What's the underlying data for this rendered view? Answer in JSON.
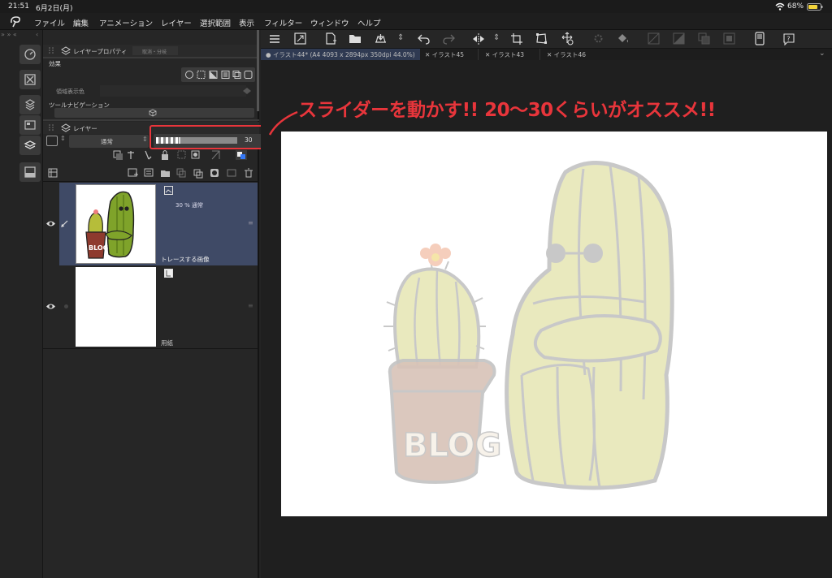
{
  "status": {
    "time": "21:51",
    "date": "6月2日(月)",
    "battery": "68%"
  },
  "menu": {
    "items": [
      "ファイル",
      "編集",
      "アニメーション",
      "レイヤー",
      "選択範囲",
      "表示",
      "フィルター",
      "ウィンドウ",
      "ヘルプ"
    ]
  },
  "panel": {
    "layer_property_tab": "レイヤープロパティ",
    "layer_property_tab2": "取消・分岐",
    "effects_label": "効果",
    "display_color_label": "領域表示色",
    "tool_nav_label": "ツールナビゲーション",
    "layer_tab": "レイヤー",
    "blend_mode": "通常",
    "opacity_value": "30"
  },
  "layers": [
    {
      "name": "トレースする画像",
      "info": "30 % 通常"
    },
    {
      "name": "用紙",
      "info": ""
    }
  ],
  "tabs": [
    {
      "label": "イラスト44* (A4 4093 x 2894px 350dpi 44.0%)"
    },
    {
      "label": "イラスト45"
    },
    {
      "label": "イラスト43"
    },
    {
      "label": "イラスト46"
    }
  ],
  "annotation": {
    "text": "スライダーを動かす!! 20～30くらいがオススメ!!"
  },
  "artwork": {
    "pot_text": "BLOG",
    "thumb_text": "BLOG"
  },
  "colors": {
    "annotation_red": "#e8353b",
    "selected_layer": "#3f4a66"
  },
  "icons": [
    "wifi-icon",
    "battery-icon",
    "app-logo-icon",
    "menu-icon",
    "undo-icon",
    "redo-icon",
    "eye-icon",
    "pen-icon",
    "trash-icon"
  ]
}
